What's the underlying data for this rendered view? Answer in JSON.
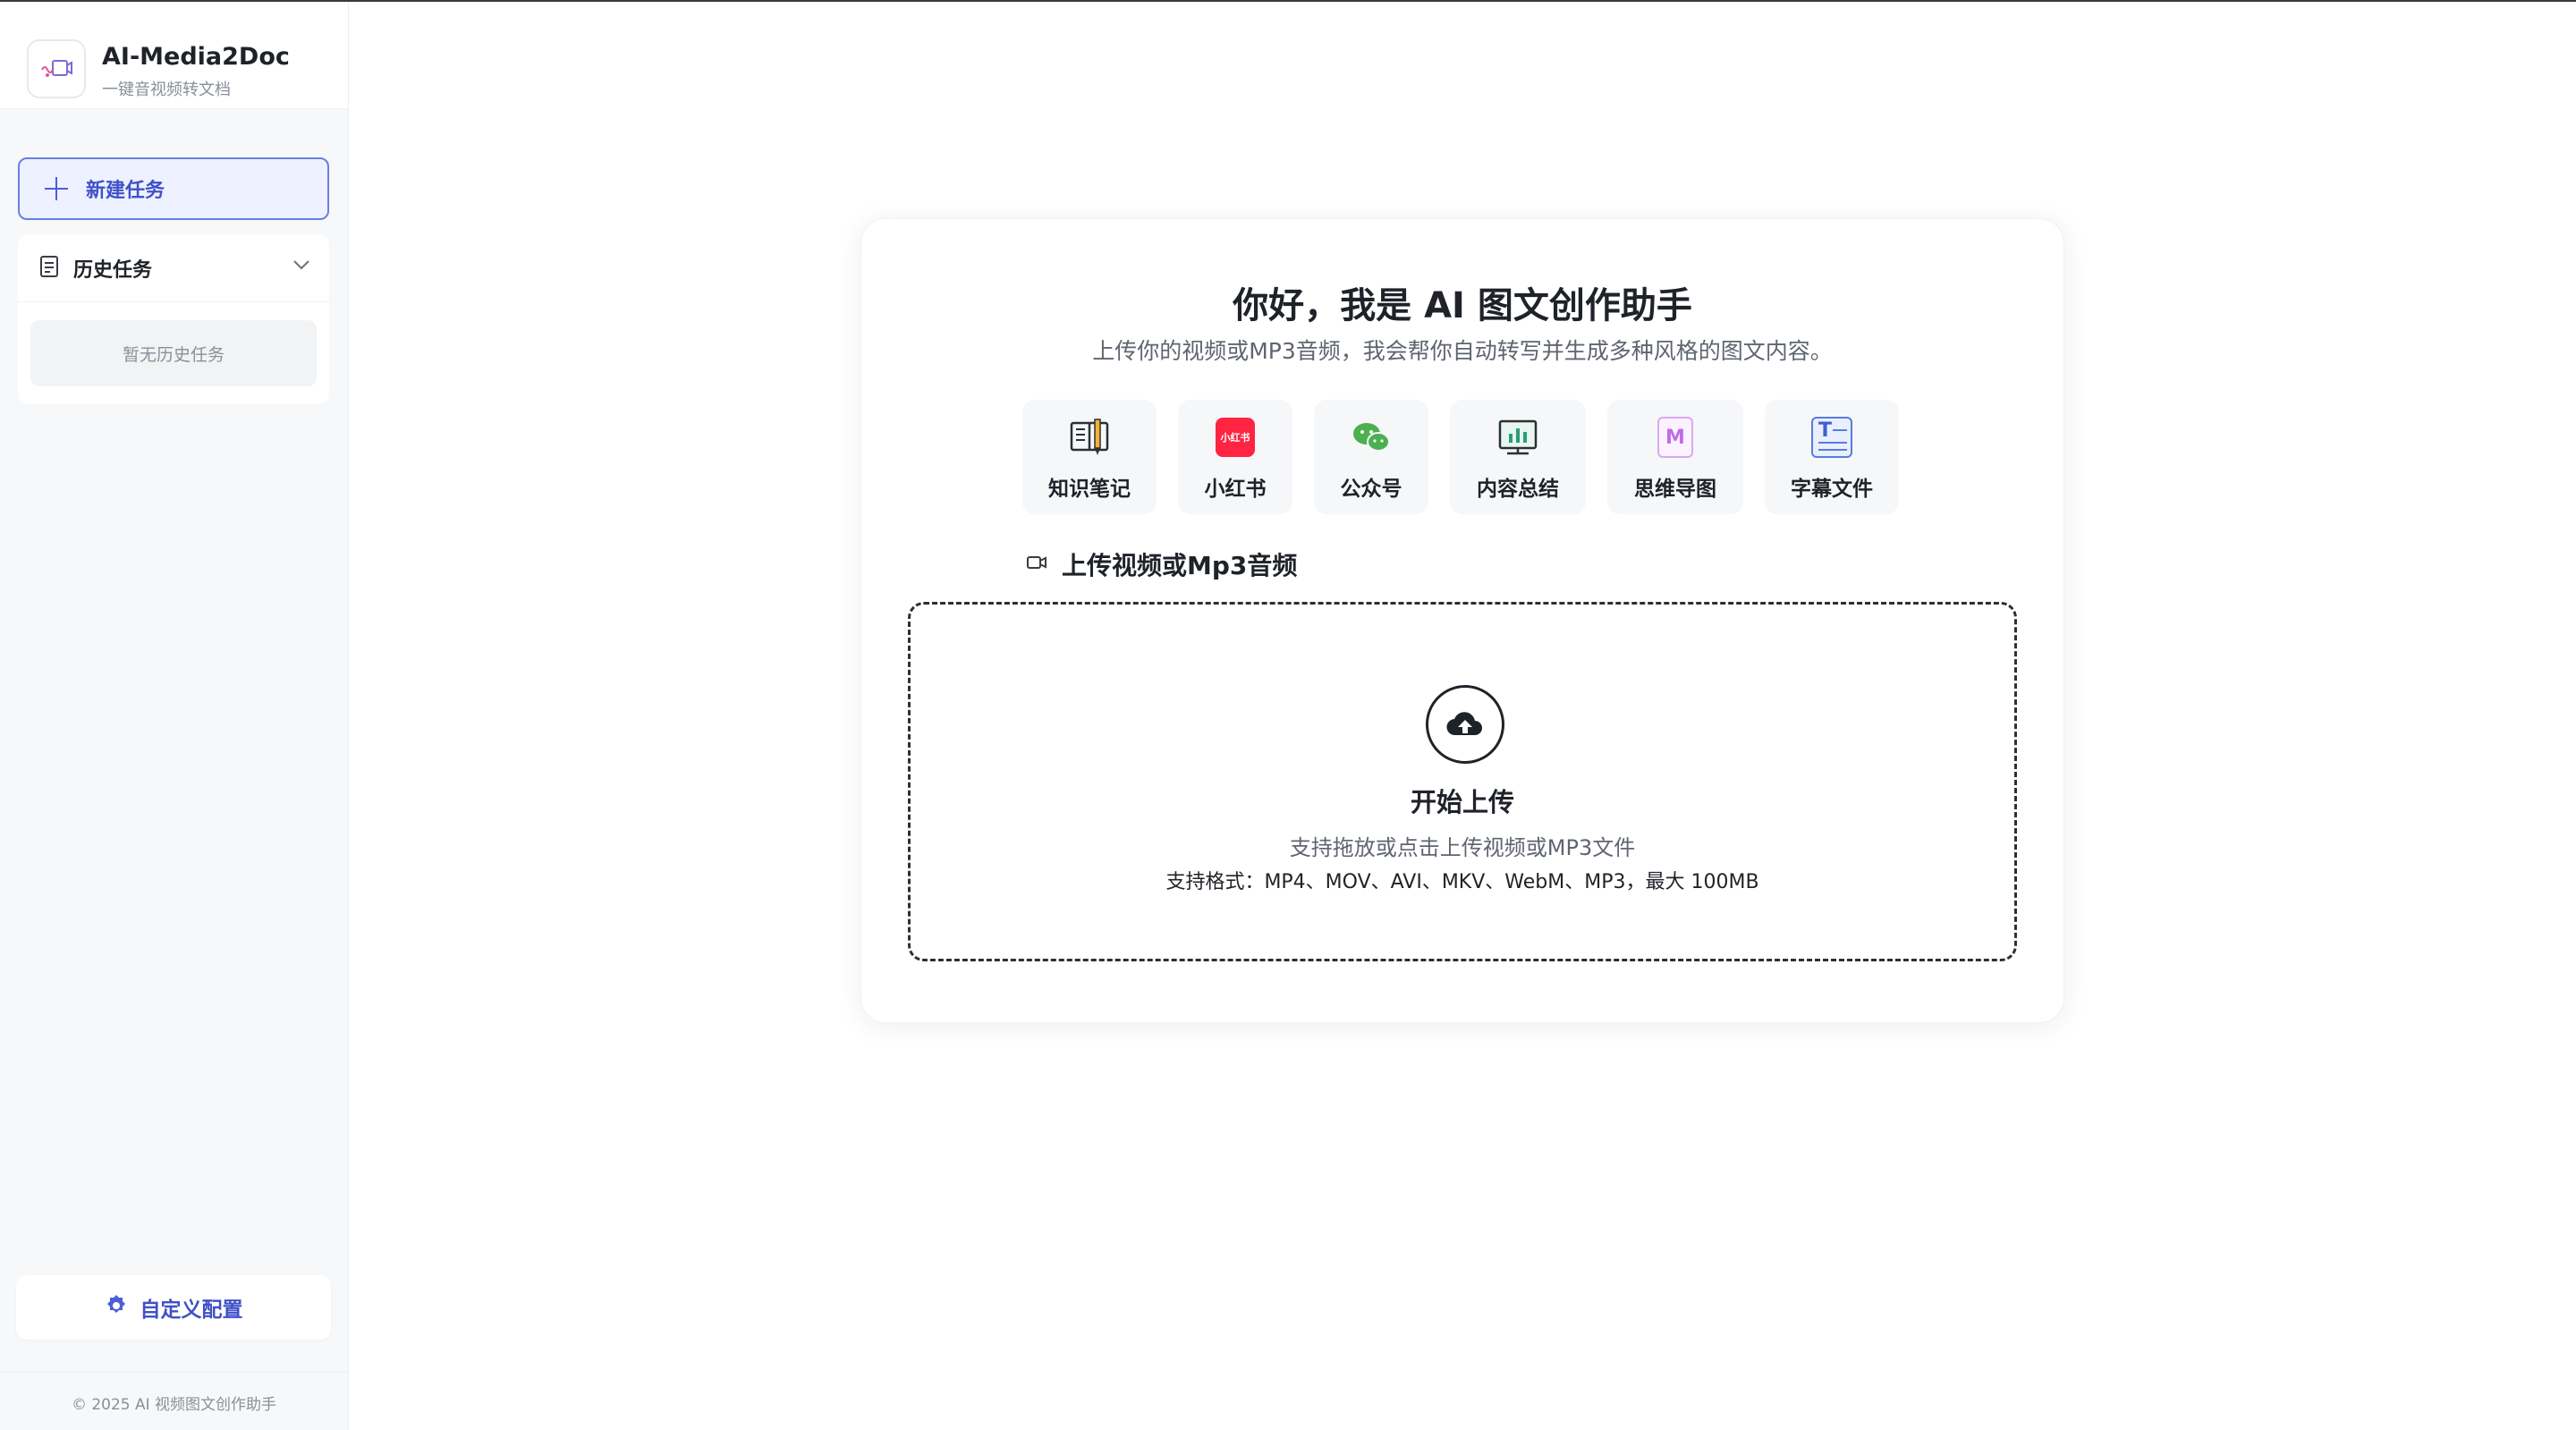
{
  "sidebar": {
    "brand": {
      "title": "AI-Media2Doc",
      "subtitle": "一键音视频转文档"
    },
    "new_task_label": "新建任务",
    "history": {
      "title": "历史任务",
      "empty_text": "暂无历史任务"
    },
    "custom_config_label": "自定义配置",
    "footer": "© 2025 AI 视频图文创作助手"
  },
  "main": {
    "title": "你好，我是 AI 图文创作助手",
    "subtitle": "上传你的视频或MP3音频，我会帮你自动转写并生成多种风格的图文内容。",
    "features": [
      {
        "label": "知识笔记",
        "icon": "book-notes-icon"
      },
      {
        "label": "小红书",
        "icon": "xiaohongshu-icon",
        "icon_text": "小红书",
        "color": "#ff2442"
      },
      {
        "label": "公众号",
        "icon": "wechat-icon",
        "color": "#4caf50"
      },
      {
        "label": "内容总结",
        "icon": "chart-board-icon"
      },
      {
        "label": "思维导图",
        "icon": "mindmap-icon",
        "icon_text": "M",
        "color": "#c36be8"
      },
      {
        "label": "字幕文件",
        "icon": "subtitle-file-icon",
        "icon_text": "T",
        "color": "#5a7be0"
      }
    ],
    "upload": {
      "heading": "上传视频或Mp3音频",
      "title": "开始上传",
      "hint": "支持拖放或点击上传视频或MP3文件",
      "formats": "支持格式：MP4、MOV、AVI、MKV、WebM、MP3，最大 100MB"
    }
  },
  "colors": {
    "accent": "#4b5fd6",
    "accent_bg": "#eef1ff",
    "sidebar_bg": "#f7f8fa",
    "feature_bg": "#f6f7f9"
  }
}
